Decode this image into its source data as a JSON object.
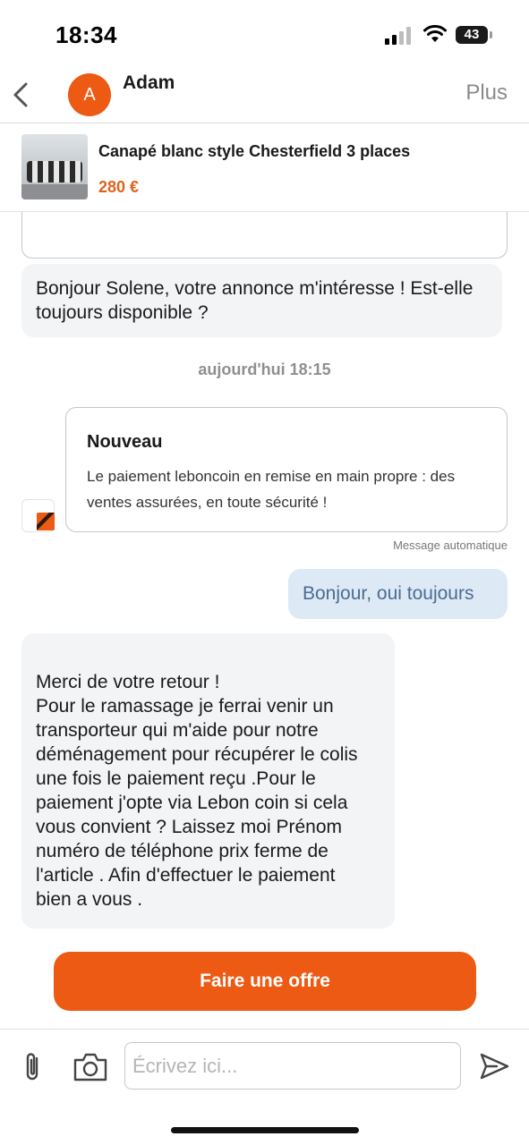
{
  "status_bar": {
    "time": "18:34",
    "battery_level": "43"
  },
  "header": {
    "avatar_initial": "A",
    "contact_name": "Adam",
    "more_label": "Plus"
  },
  "product": {
    "title": "Canapé blanc style Chesterfield 3 places",
    "price": "280 €"
  },
  "messages": {
    "first_incoming": "Bonjour Solene, votre annonce m'intéresse ! Est-elle toujours disponible ?",
    "date_separator": "aujourd'hui 18:15",
    "system_card": {
      "title": "Nouveau",
      "text": "Le paiement leboncoin en remise en main propre : des ventes assurées, en toute sécurité !",
      "auto_label": "Message automatique"
    },
    "outgoing": "Bonjour, oui toujours",
    "second_incoming": "Merci de votre retour !\nPour  le ramassage  je ferrai venir un transporteur qui m'aide pour notre déménagement pour récupérer le colis une fois le paiement reçu .Pour le paiement j'opte via Lebon coin si cela vous convient ? Laissez moi Prénom numéro de téléphone prix ferme de l'article . Afin d'effectuer le paiement\nbien a vous ."
  },
  "cta": {
    "offer_label": "Faire une offre"
  },
  "composer": {
    "placeholder": "Écrivez ici..."
  },
  "colors": {
    "accent": "#ec5a13",
    "outgoing_bubble": "#dde9f5",
    "incoming_bubble": "#f2f4f6",
    "price": "#e0631d"
  },
  "icons": {
    "back": "chevron-left-icon",
    "attach": "paperclip-icon",
    "camera": "camera-icon",
    "send": "send-icon",
    "signal": "cellular-signal-icon",
    "wifi": "wifi-icon",
    "battery": "battery-icon",
    "system": "leboncoin-logo-icon"
  }
}
